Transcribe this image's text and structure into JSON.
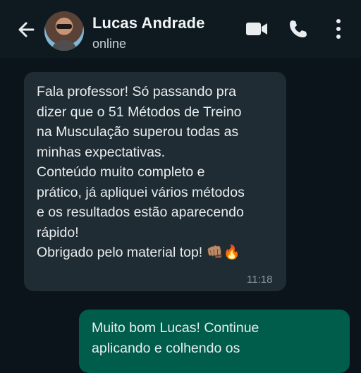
{
  "header": {
    "contact_name": "Lucas Andrade",
    "status": "online",
    "icons": [
      "back-arrow-icon",
      "video-call-icon",
      "phone-icon",
      "more-vert-icon"
    ]
  },
  "messages": [
    {
      "direction": "incoming",
      "text": "Fala professor! Só passando pra\ndizer que o 51 Métodos de Treino\nna Musculação superou todas as\nminhas expectativas.\nConteúdo muito completo e\nprático, já apliquei vários métodos\ne os resultados estão aparecendo\nrápido!\nObrigado pelo material top! 👊🏽🔥",
      "time": "11:18"
    },
    {
      "direction": "outgoing",
      "text": "Muito bom Lucas! Continue\naplicando e colhendo os"
    }
  ],
  "colors": {
    "background": "#0b141a",
    "header": "#0f1a20",
    "incoming_bubble": "#202c33",
    "outgoing_bubble": "#005c4b",
    "text": "#e9edef"
  }
}
